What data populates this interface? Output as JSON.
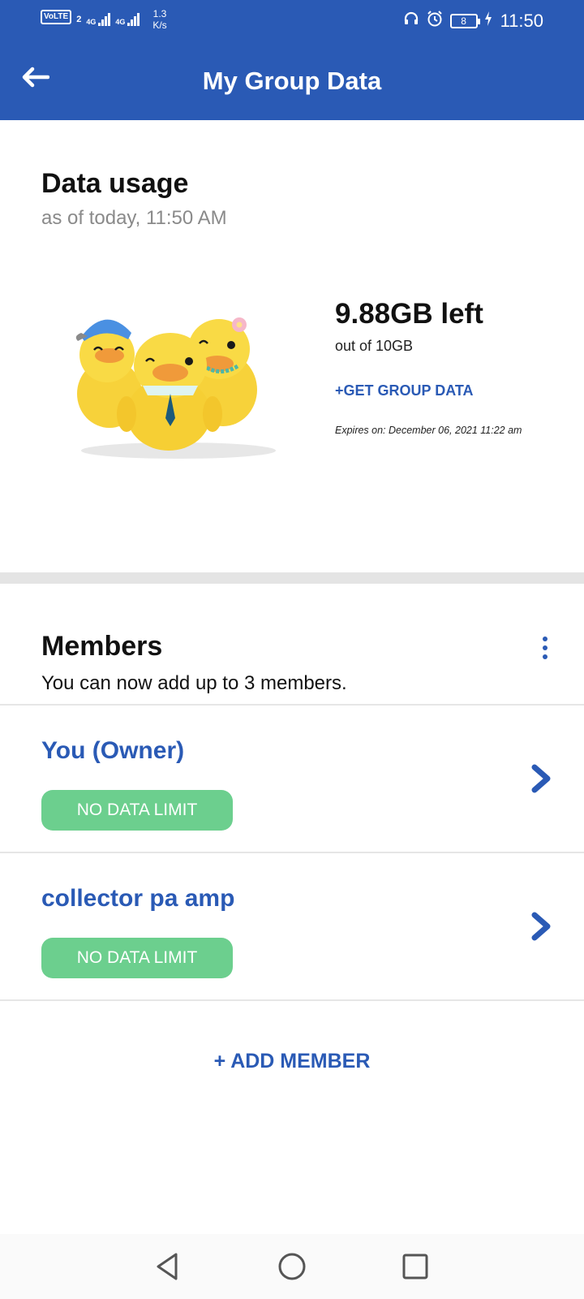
{
  "status_bar": {
    "volte": "VoLTE",
    "sim_label": "2",
    "net1": "4G",
    "net2": "4G",
    "speed_value": "1.3",
    "speed_unit": "K/s",
    "battery": "8",
    "time": "11:50",
    "icons": [
      "headphones-icon",
      "alarm-icon",
      "battery-icon",
      "charging-icon"
    ]
  },
  "header": {
    "title": "My Group Data",
    "back_icon": "arrow-left-icon",
    "background": "#2a5ab5"
  },
  "usage": {
    "title": "Data usage",
    "as_of": "as of today, 11:50 AM",
    "illustration": "ducks-family-illustration",
    "remaining": "9.88GB left",
    "total": "out of 10GB",
    "get_data_label": "+GET GROUP DATA",
    "expires": "Expires on: December 06, 2021 11:22 am"
  },
  "members": {
    "title": "Members",
    "subtitle": "You can now add up to 3 members.",
    "menu_icon": "more-vertical-icon",
    "list": [
      {
        "name": "You (Owner)",
        "badge": "NO DATA LIMIT"
      },
      {
        "name": "collector pa amp",
        "badge": "NO DATA LIMIT"
      }
    ],
    "add_label": "+ ADD MEMBER"
  },
  "colors": {
    "accent": "#2a5ab5",
    "badge": "#6ccf8e",
    "muted_text": "#8a8a8a"
  },
  "nav": {
    "icons": [
      "back-triangle-icon",
      "home-circle-icon",
      "recents-square-icon"
    ]
  }
}
